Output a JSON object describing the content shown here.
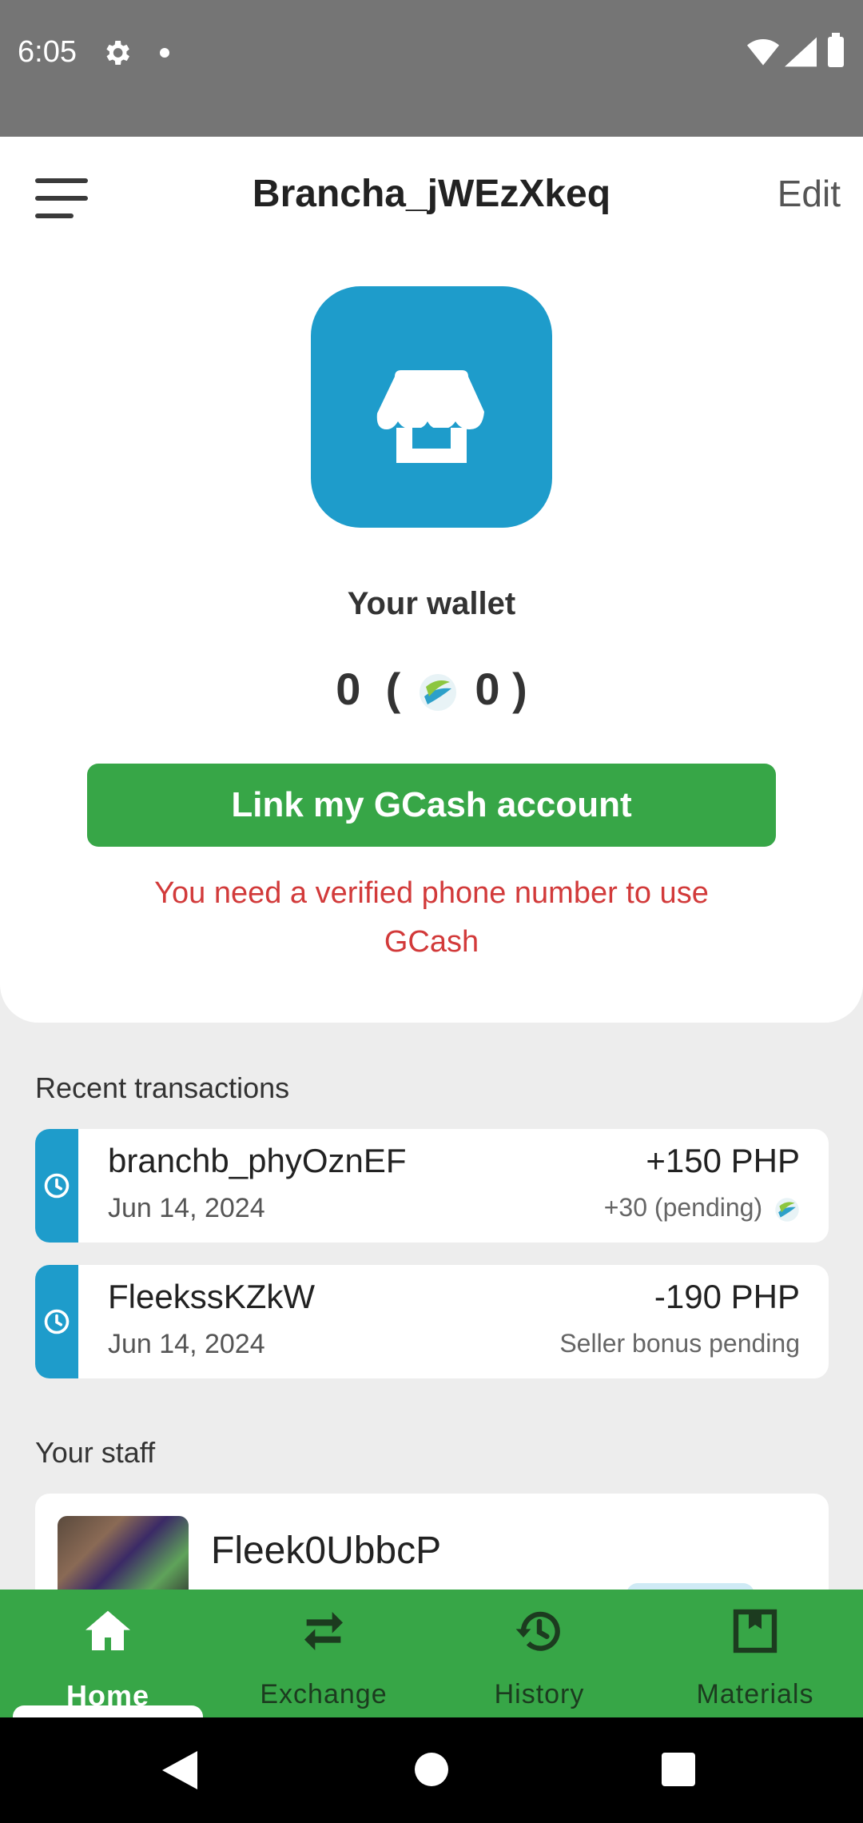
{
  "status_bar": {
    "time": "6:05"
  },
  "header": {
    "title": "Brancha_jWEzXkeq",
    "edit_label": "Edit"
  },
  "wallet": {
    "label": "Your wallet",
    "balance": "0",
    "open_paren": "(",
    "bonus_balance": "0",
    "close_paren": ")",
    "gcash_button": "Link my GCash account",
    "warning": "You need a verified phone number to use GCash"
  },
  "transactions": {
    "section_label": "Recent transactions",
    "items": [
      {
        "name": "branchb_phyOznEF",
        "date": "Jun 14, 2024",
        "amount": "+150 PHP",
        "sub": "+30 (pending)"
      },
      {
        "name": "FleekssKZkW",
        "date": "Jun 14, 2024",
        "amount": "-190 PHP",
        "sub": "Seller bonus pending"
      }
    ]
  },
  "staff": {
    "section_label": "Your staff",
    "items": [
      {
        "name": "Fleek0UbbcP"
      }
    ]
  },
  "bottom_nav": {
    "items": [
      {
        "label": "Home",
        "icon": "home-icon",
        "active": true
      },
      {
        "label": "Exchange",
        "icon": "swap-icon",
        "active": false
      },
      {
        "label": "History",
        "icon": "history-icon",
        "active": false
      },
      {
        "label": "Materials",
        "icon": "bookmark-icon",
        "active": false
      }
    ]
  },
  "colors": {
    "accent_blue": "#1e9ccb",
    "green": "#37a647",
    "warning_red": "#d23a3a"
  }
}
